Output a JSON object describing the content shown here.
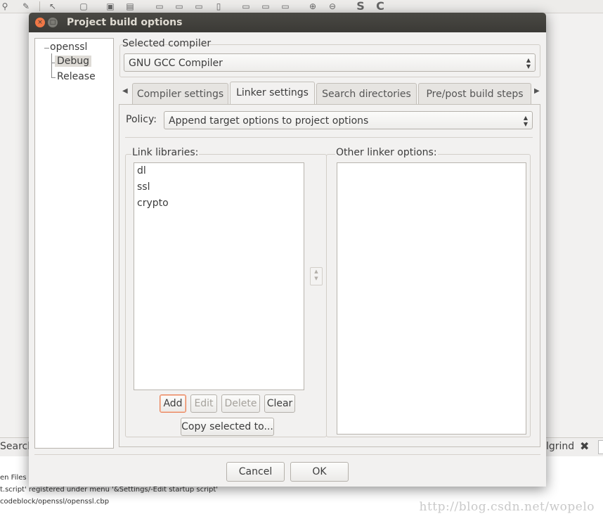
{
  "background": {
    "log_tab_left": "Search",
    "log_tab_right": "lgrind",
    "log_lines": [
      "en Files p",
      "t.script' registered under menu '&Settings/-Edit startup script'",
      "codeblock/openssl/openssl.cbp"
    ],
    "watermark": "http://blog.csdn.net/wopelo"
  },
  "dialog": {
    "title": "Project build options",
    "close_glyph": "×",
    "maximize_glyph": "□",
    "tree": {
      "root": "openssl",
      "children": [
        "Debug",
        "Release"
      ],
      "selected": "Debug"
    },
    "selected_compiler_label": "Selected compiler",
    "compiler_value": "GNU GCC Compiler",
    "tabs": [
      "Compiler settings",
      "Linker settings",
      "Search directories",
      "Pre/post build steps"
    ],
    "active_tab": "Linker settings",
    "policy_label": "Policy:",
    "policy_value": "Append target options to project options",
    "link_libraries_label": "Link libraries:",
    "link_libraries": [
      "dl",
      "ssl",
      "crypto"
    ],
    "other_linker_label": "Other linker options:",
    "other_linker_value": "",
    "buttons": {
      "add": "Add",
      "edit": "Edit",
      "delete": "Delete",
      "clear": "Clear",
      "copy_selected": "Copy selected to...",
      "cancel": "Cancel",
      "ok": "OK"
    }
  }
}
